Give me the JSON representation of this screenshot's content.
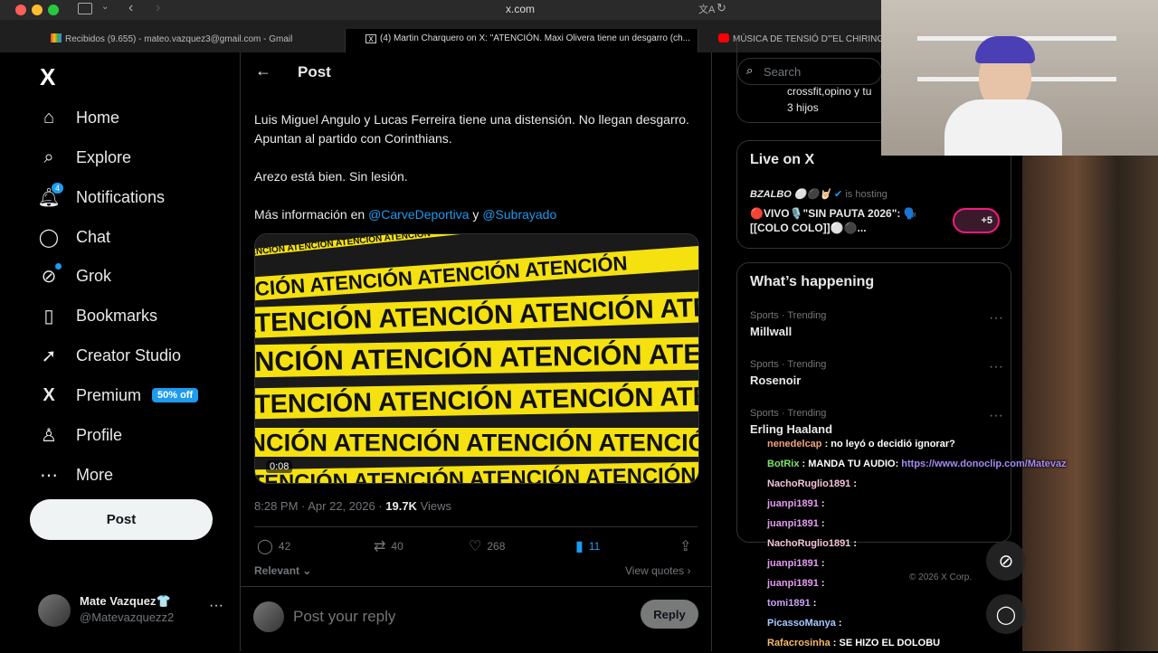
{
  "browser": {
    "url": "x.com",
    "tabs": [
      {
        "label": "Recibidos (9.655) - mateo.vazquez3@gmail.com - Gmail",
        "active": false
      },
      {
        "label": "(4) Martin Charquero on X: \"ATENCIÓN. Maxi Olivera tiene un desgarro (ch...",
        "active": true
      },
      {
        "label": "MÚSICA DE TENSIÓ D'\"EL CHIRING",
        "active": false
      }
    ]
  },
  "sidebar": {
    "logo": "X",
    "items": [
      {
        "label": "Home",
        "icon": "home-icon"
      },
      {
        "label": "Explore",
        "icon": "search-icon"
      },
      {
        "label": "Notifications",
        "icon": "bell-icon",
        "badge": "4"
      },
      {
        "label": "Chat",
        "icon": "chat-icon"
      },
      {
        "label": "Grok",
        "icon": "grok-icon"
      },
      {
        "label": "Bookmarks",
        "icon": "bookmark-icon"
      },
      {
        "label": "Creator Studio",
        "icon": "rocket-icon"
      },
      {
        "label": "Premium",
        "icon": "x-logo-icon",
        "pill": "50% off"
      },
      {
        "label": "Profile",
        "icon": "person-icon"
      },
      {
        "label": "More",
        "icon": "more-circle-icon"
      }
    ],
    "post_label": "Post",
    "account": {
      "name": "Mate Vazquez👕",
      "handle": "@Matevazquezz2",
      "more": "···"
    }
  },
  "main": {
    "header_title": "Post",
    "text_p1": "Luis Miguel Angulo y Lucas Ferreira tiene una distensión. No llegan desgarro. Apuntan al partido con Corinthians.",
    "text_p2": "Arezo está bien. Sin lesión.",
    "text_p3_prefix": "Más información en ",
    "mention1": "@CarveDeportiva",
    "text_p3_mid": " y ",
    "mention2": "@Subrayado",
    "media": {
      "banner_word": "ATENCIÓN",
      "duration": "0:08"
    },
    "meta": {
      "time": "8:28 PM · Apr 22, 2026 · ",
      "views_count": "19.7K",
      "views_label": " Views"
    },
    "actions": {
      "replies": "42",
      "reposts": "40",
      "likes": "268",
      "bookmarks": "11"
    },
    "relevant": "Relevant",
    "view_quotes": "View quotes",
    "reply_placeholder": "Post your reply",
    "reply_button": "Reply"
  },
  "right": {
    "search_placeholder": "Search",
    "top_snippet_1": "crossfit,opino y tu",
    "top_snippet_2": "3 hijos",
    "live": {
      "title": "Live on X",
      "host": "BZALBO ⚪⚫🤘🏻",
      "hosting": "is hosting",
      "stream_title": "🔴VIVO🎙️\"SIN PAUTA 2026\": 🗣️ [[COLO COLO]]⚪⚫...",
      "listeners": "+5"
    },
    "happening": {
      "title": "What’s happening",
      "trends": [
        {
          "category": "Sports · Trending",
          "name": "Millwall"
        },
        {
          "category": "Sports · Trending",
          "name": "Rosenoir"
        },
        {
          "category": "Sports · Trending",
          "name": "Erling Haaland"
        }
      ]
    },
    "footer": {
      "copyright": "© 2026 X Corp."
    }
  },
  "stream_chat": [
    {
      "user": "nenedelcap",
      "color": "#f2a37b",
      "msg": ": no leyó o decidió ignorar?"
    },
    {
      "user": "BotRix",
      "color": "#7fe16b",
      "msg": ": MANDA TU AUDIO: ",
      "link": "https://www.donoclip.com/Matevaz"
    },
    {
      "user": "NachoRuglio1891",
      "color": "#f2c3d8",
      "msg": ":"
    },
    {
      "user": "juanpi1891",
      "color": "#e39df2",
      "msg": ":"
    },
    {
      "user": "juanpi1891",
      "color": "#e39df2",
      "msg": ":"
    },
    {
      "user": "NachoRuglio1891",
      "color": "#f2c3d8",
      "msg": ":"
    },
    {
      "user": "juanpi1891",
      "color": "#e39df2",
      "msg": ":"
    },
    {
      "user": "juanpi1891",
      "color": "#e39df2",
      "msg": ":"
    },
    {
      "user": "tomi1891",
      "color": "#c9a2f5",
      "msg": ":"
    },
    {
      "user": "PicassoManya",
      "color": "#a7c7ff",
      "msg": ":"
    },
    {
      "user": "Rafacrosinha",
      "color": "#f5b96b",
      "msg": ": SE HIZO EL DOLOBU"
    }
  ],
  "colors": {
    "accent": "#1d9bf0",
    "bg": "#000000",
    "muted": "#71767b"
  }
}
